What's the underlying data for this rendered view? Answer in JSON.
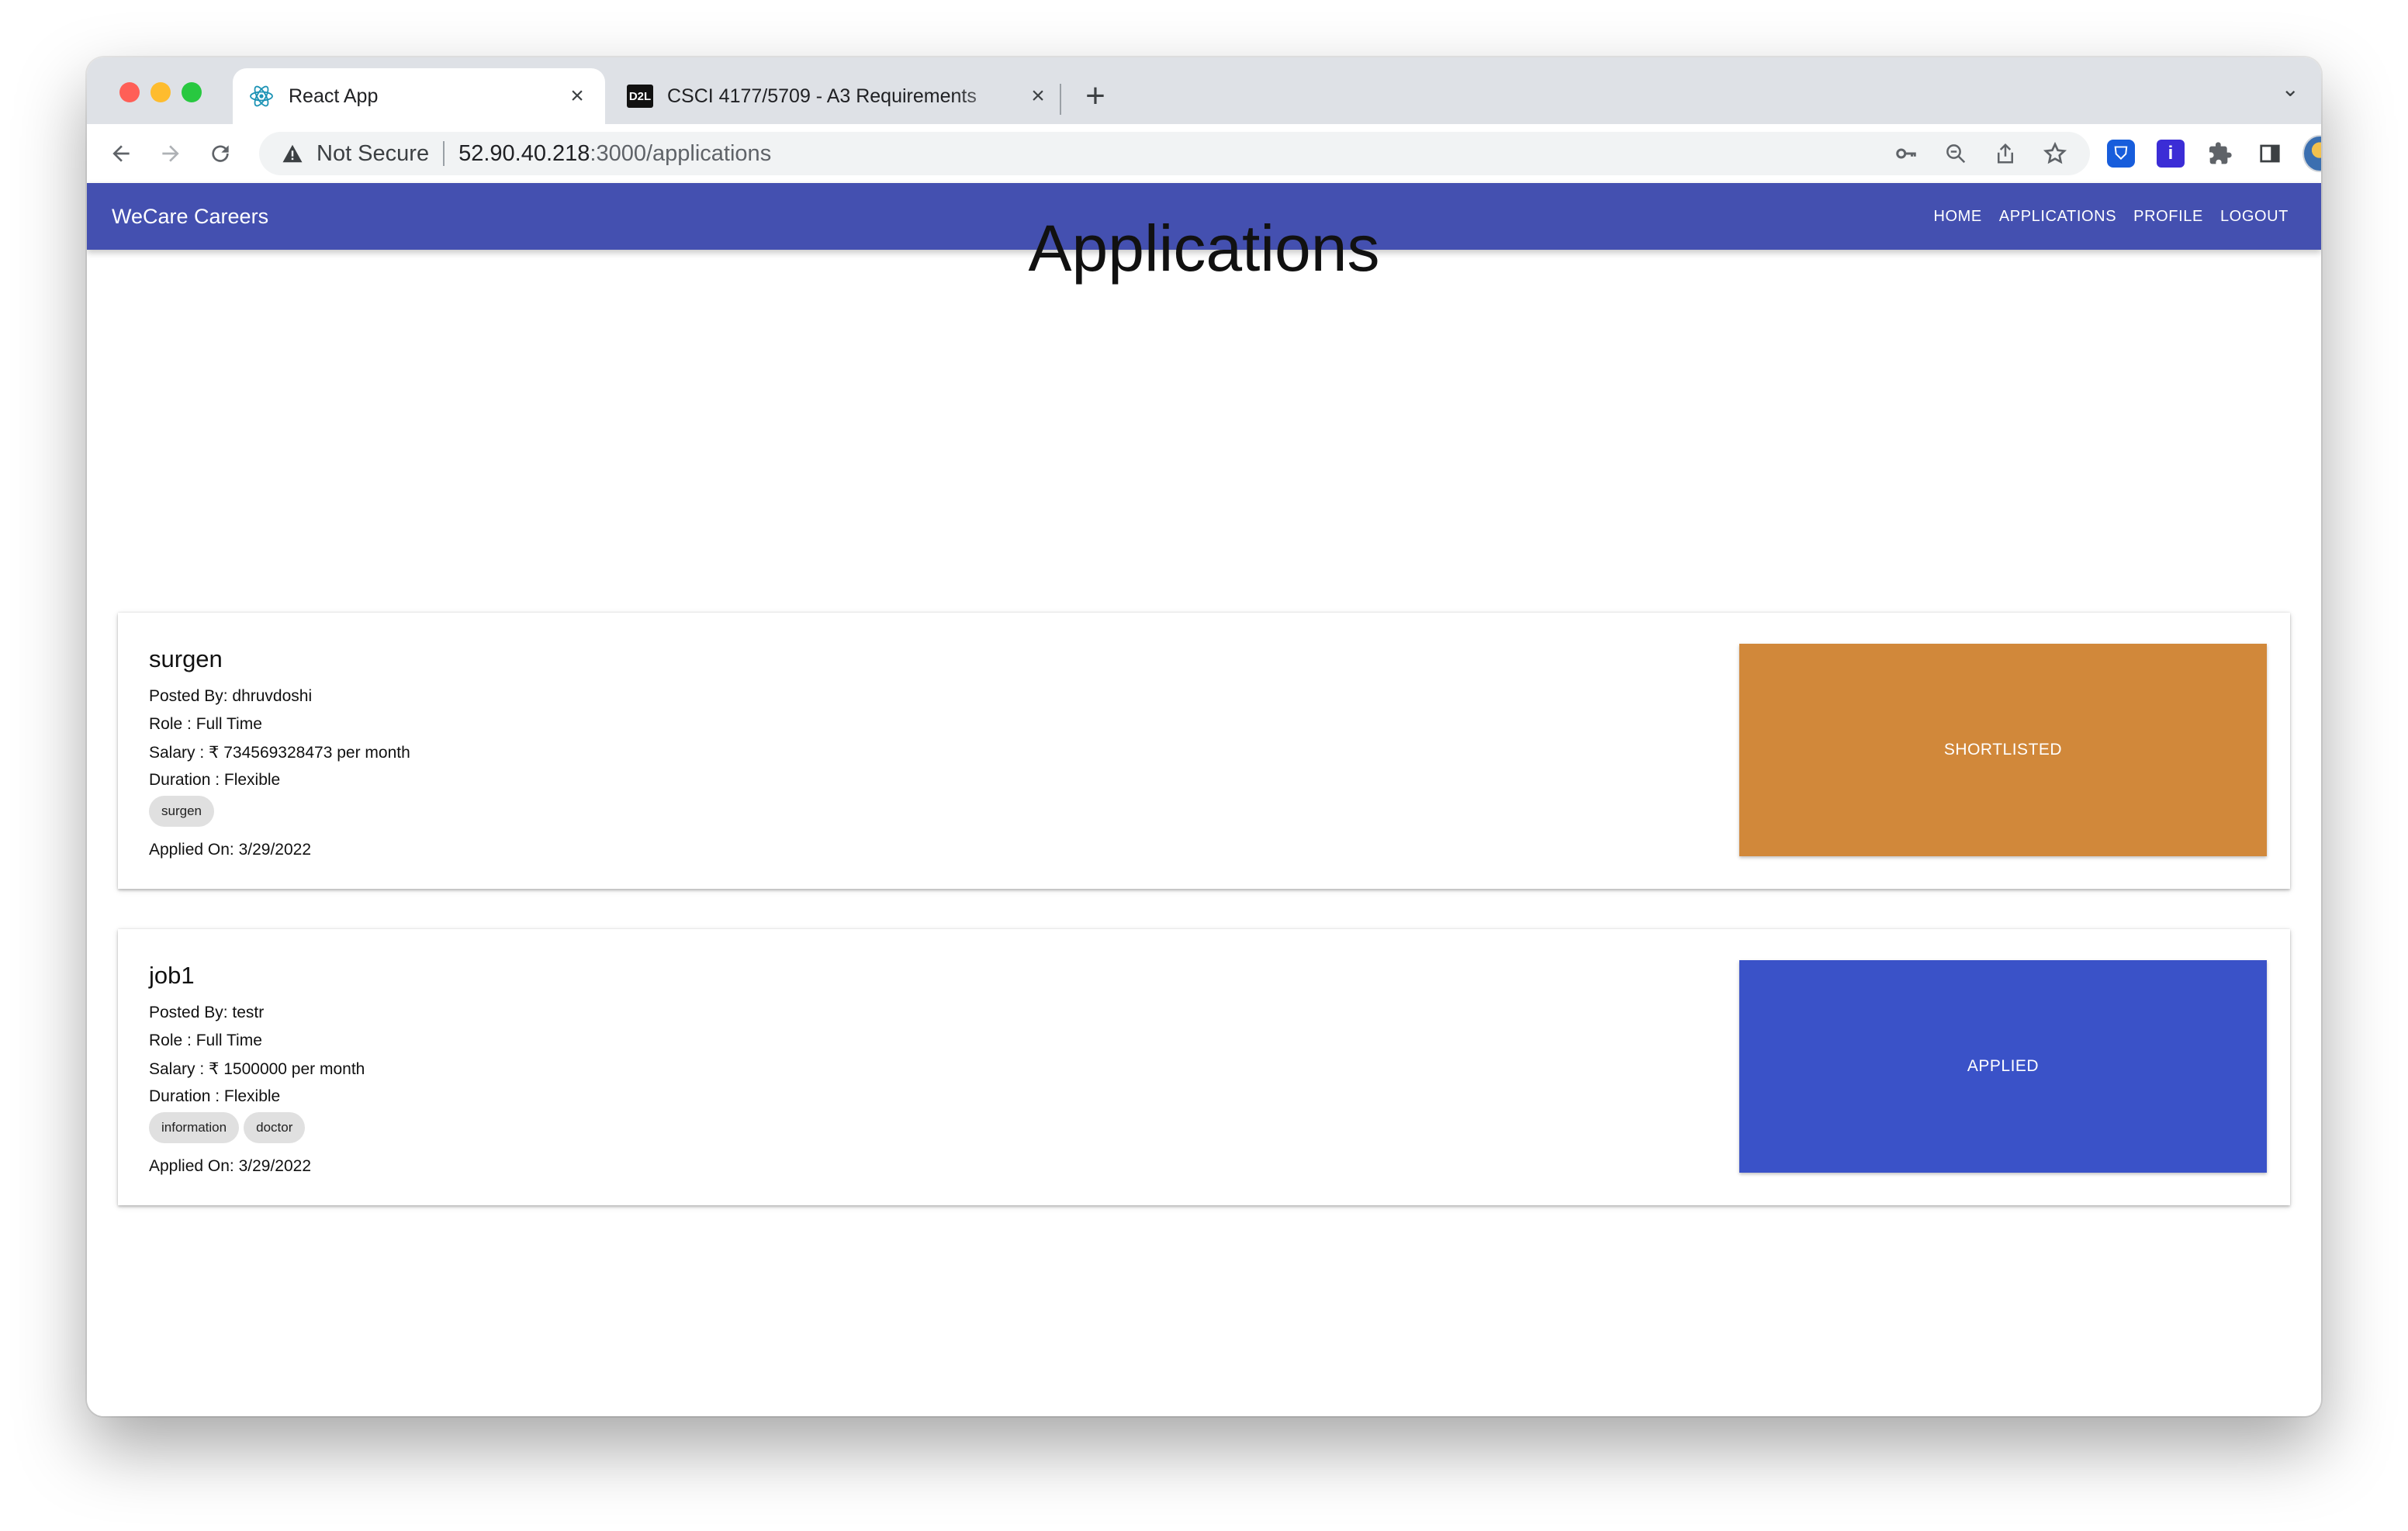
{
  "browser": {
    "tabs": [
      {
        "title": "React App",
        "favicon": "react-icon",
        "active": true
      },
      {
        "title": "CSCI 4177/5709 - A3 Requirements",
        "favicon": "d2l-icon",
        "favicon_text": "D2L",
        "active": false
      }
    ],
    "address": {
      "security_label": "Not Secure",
      "host": "52.90.40.218",
      "path": ":3000/applications"
    }
  },
  "app": {
    "brand": "WeCare Careers",
    "nav": [
      "HOME",
      "APPLICATIONS",
      "PROFILE",
      "LOGOUT"
    ],
    "page_title": "Applications",
    "applications": [
      {
        "title": "surgen",
        "posted_by": "Posted By: dhruvdoshi",
        "role": "Role : Full Time",
        "salary": "Salary : ₹ 734569328473 per month",
        "duration": "Duration : Flexible",
        "tags": [
          "surgen"
        ],
        "applied_on": "Applied On: 3/29/2022",
        "status": "SHORTLISTED",
        "status_color": "#d1883a"
      },
      {
        "title": "job1",
        "posted_by": "Posted By: testr",
        "role": "Role : Full Time",
        "salary": "Salary : ₹ 1500000 per month",
        "duration": "Duration : Flexible",
        "tags": [
          "information",
          "doctor"
        ],
        "applied_on": "Applied On: 3/29/2022",
        "status": "APPLIED",
        "status_color": "#3a52c8"
      }
    ]
  },
  "colors": {
    "appbar": "#4450b0",
    "shortlisted": "#d1883a",
    "applied": "#3a52c8"
  }
}
